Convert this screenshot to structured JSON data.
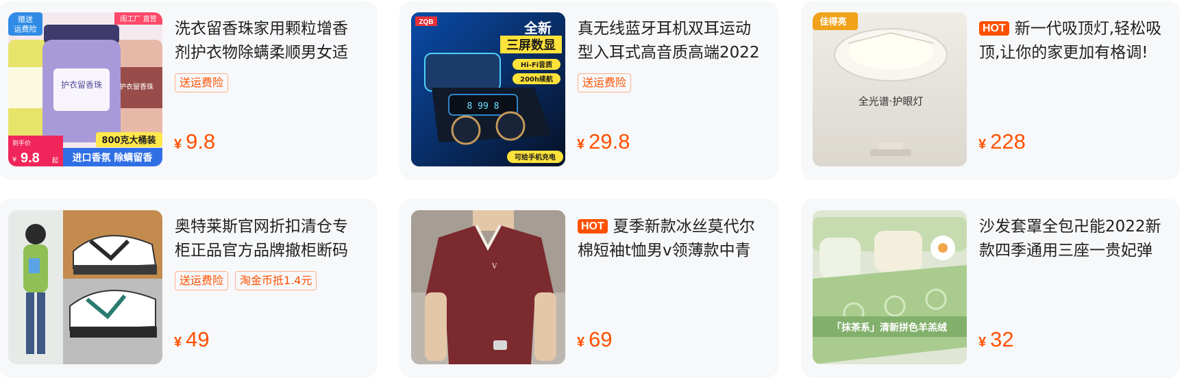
{
  "colors": {
    "accent": "#ff5000",
    "card_bg": "#f7f8fa",
    "tag_border": "#ffb089"
  },
  "products": [
    {
      "title": "洗衣留香珠家用颗粒增香剂护衣物除螨柔顺男女适",
      "hot": "",
      "tags": [
        "送运费险"
      ],
      "currency": "¥",
      "price": "9.8",
      "image": {
        "badge_top_left": "赠送\n运费险",
        "badge_top_right": "闺工厂 直营",
        "jar_label": "护衣留香珠",
        "size_label": "800克大桶装",
        "bottom_price_label": "到手价",
        "bottom_price": "9.8",
        "bottom_price_suffix": "起",
        "bottom_banner": "进口香氛 除螨留香"
      }
    },
    {
      "title": "真无线蓝牙耳机双耳运动型入耳式高音质高端2022",
      "hot": "",
      "tags": [
        "送运费险"
      ],
      "currency": "¥",
      "price": "29.8",
      "image": {
        "brand": "ZQB",
        "headline_1": "全新",
        "headline_2": "三屏数显",
        "feature_1": "Hi-Fi音质",
        "feature_2": "200h续航",
        "footer": "可给手机充电",
        "display_digits": "99"
      }
    },
    {
      "title": "新一代吸顶灯,轻松吸顶,让你的家更加有格调!",
      "hot": "HOT",
      "tags": [],
      "currency": "¥",
      "price": "228",
      "image": {
        "brand": "佳得亮",
        "caption": "全光谱·护眼灯"
      }
    },
    {
      "title": "奥特莱斯官网折扣清仓专柜正品官方品牌撤柜断码",
      "hot": "",
      "tags": [
        "送运费险",
        "淘金币抵1.4元"
      ],
      "currency": "¥",
      "price": "49",
      "image": {}
    },
    {
      "title": "夏季新款冰丝莫代尔棉短袖t恤男v领薄款中青",
      "hot": "HOT",
      "tags": [],
      "currency": "¥",
      "price": "69",
      "image": {}
    },
    {
      "title": "沙发套罩全包卍能2022新款四季通用三座一贵妃弹",
      "hot": "",
      "tags": [],
      "currency": "¥",
      "price": "32",
      "image": {
        "caption": "「抹茶系」清新拼色羊羔绒"
      }
    }
  ]
}
